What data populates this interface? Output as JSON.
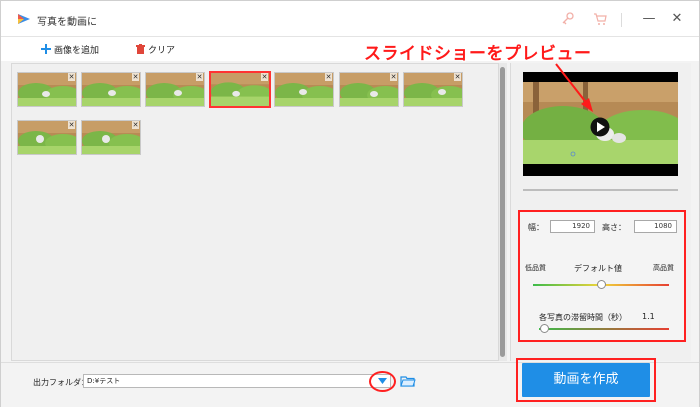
{
  "window": {
    "title": "写真を動画に"
  },
  "titlebar": {
    "icons": [
      "key-icon",
      "cart-icon",
      "minimize-icon",
      "close-icon"
    ],
    "minimize_glyph": "—",
    "close_glyph": "✕"
  },
  "toolbar": {
    "add_label": "画像を追加",
    "clear_label": "クリア"
  },
  "callout": {
    "text": "スライドショーをプレビュー"
  },
  "gallery": {
    "thumbnails": [
      {
        "selected": false
      },
      {
        "selected": false
      },
      {
        "selected": false
      },
      {
        "selected": true
      },
      {
        "selected": false
      },
      {
        "selected": false
      },
      {
        "selected": false
      },
      {
        "selected": false
      },
      {
        "selected": false
      }
    ],
    "remove_glyph": "✕"
  },
  "settings": {
    "width_label": "幅：",
    "width_value": "1920",
    "height_label": "高さ：",
    "height_value": "1080",
    "quality_low": "低品質",
    "quality_default": "デフォルト値",
    "quality_high": "高品質",
    "quality_level": 0.5,
    "duration_label": "各写真の滞留時間（秒）",
    "duration_value": "1.1",
    "duration_level": 0.04
  },
  "output": {
    "label": "出力フォルダ：",
    "path": "D:¥テスト"
  },
  "actions": {
    "create_label": "動画を作成"
  },
  "colors": {
    "accent": "#1f8ee6",
    "highlight": "#ff2020"
  }
}
